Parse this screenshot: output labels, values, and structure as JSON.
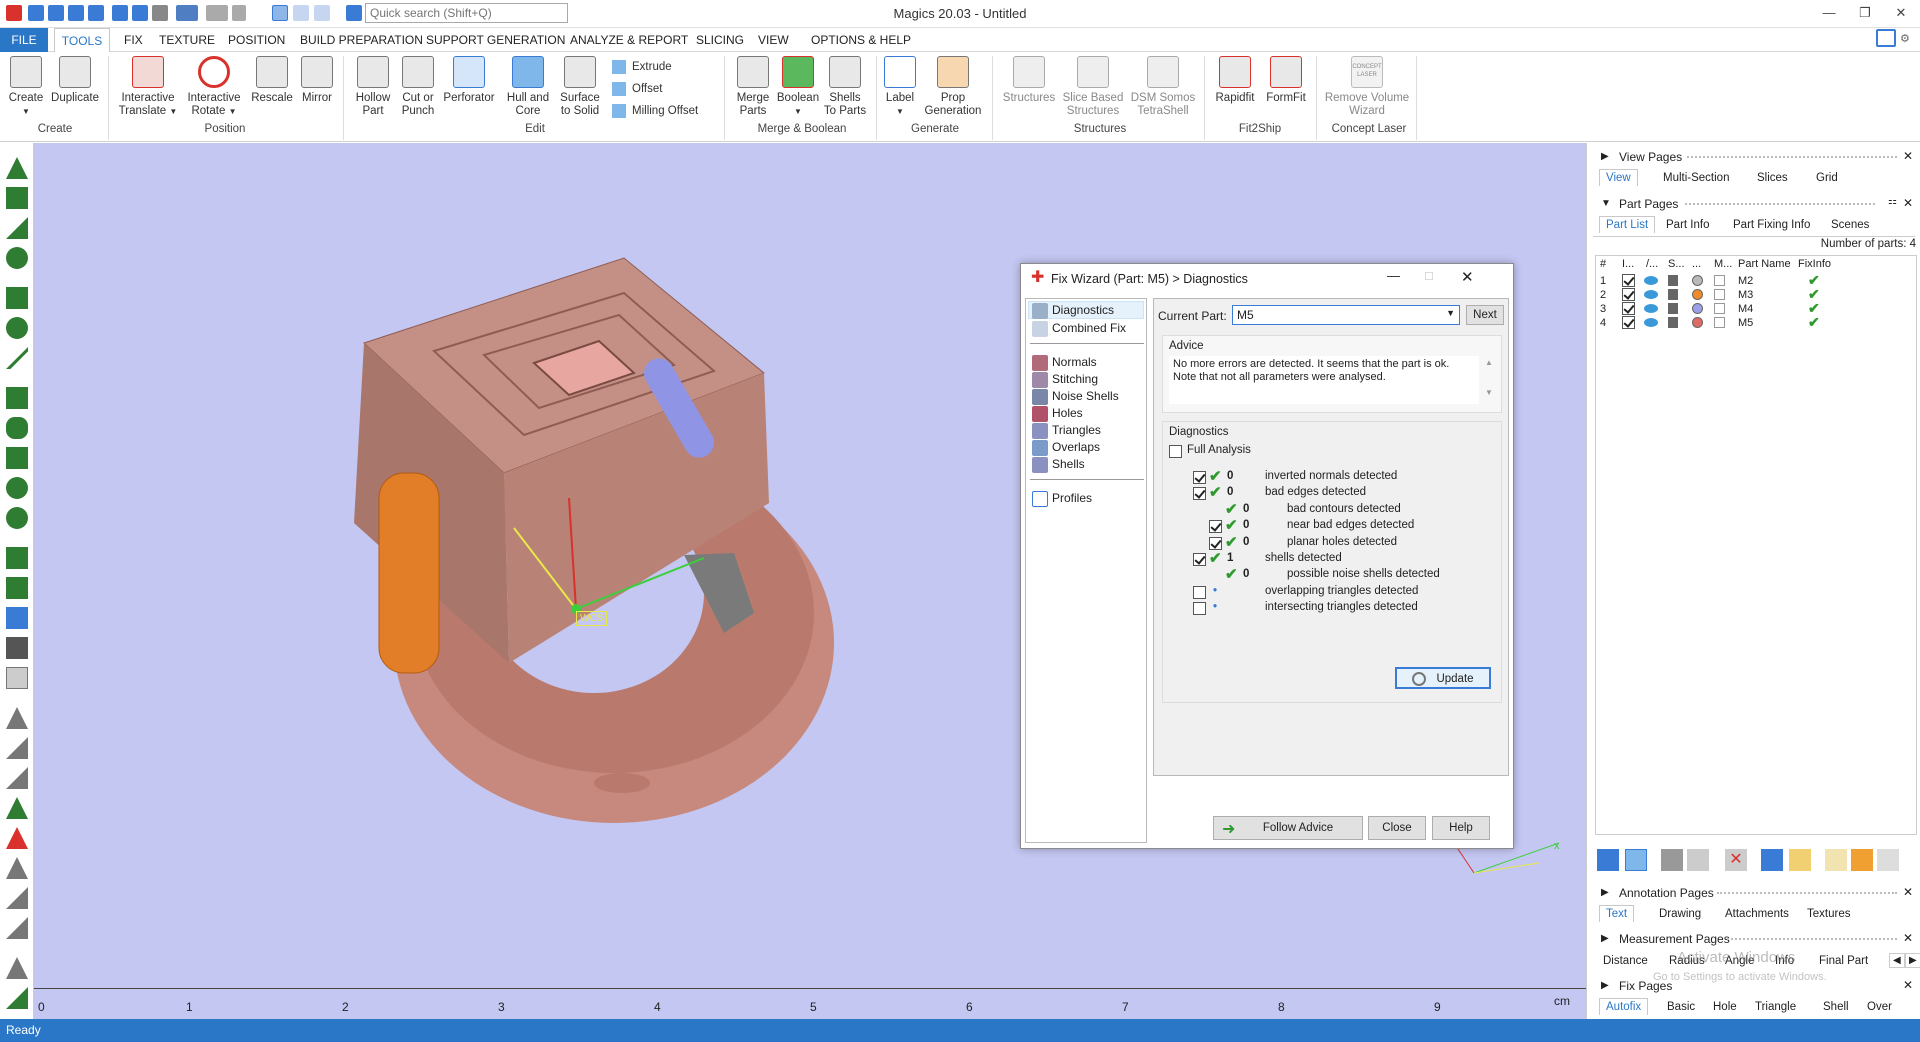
{
  "app": {
    "title": "Magics 20.03 - Untitled",
    "search_placeholder": "Quick search (Shift+Q)",
    "status": "Ready"
  },
  "menu": {
    "file": "FILE",
    "tabs": [
      "TOOLS",
      "FIX",
      "TEXTURE",
      "POSITION",
      "BUILD PREPARATION",
      "SUPPORT GENERATION",
      "ANALYZE & REPORT",
      "SLICING",
      "VIEW",
      "OPTIONS & HELP"
    ]
  },
  "ribbon": {
    "create": {
      "label": "Create",
      "btn_create": "Create",
      "btn_duplicate": "Duplicate"
    },
    "position": {
      "label": "Position",
      "interactive_translate_1": "Interactive",
      "interactive_translate_2": "Translate",
      "interactive_rotate_1": "Interactive",
      "interactive_rotate_2": "Rotate",
      "rescale": "Rescale",
      "mirror": "Mirror"
    },
    "edit": {
      "label": "Edit",
      "hollow_1": "Hollow",
      "hollow_2": "Part",
      "cut_1": "Cut or",
      "cut_2": "Punch",
      "perforator": "Perforator",
      "hull_1": "Hull and",
      "hull_2": "Core",
      "surface_1": "Surface",
      "surface_2": "to Solid",
      "extrude": "Extrude",
      "offset": "Offset",
      "milling": "Milling Offset"
    },
    "merge": {
      "label": "Merge & Boolean",
      "merge_1": "Merge",
      "merge_2": "Parts",
      "boolean": "Boolean",
      "shells_1": "Shells",
      "shells_2": "To Parts"
    },
    "generate": {
      "label": "Generate",
      "label_btn": "Label",
      "prop_1": "Prop",
      "prop_2": "Generation"
    },
    "structures": {
      "label": "Structures",
      "structures_btn": "Structures",
      "slice_1": "Slice Based",
      "slice_2": "Structures",
      "dsm_1": "DSM Somos",
      "dsm_2": "TetraShell"
    },
    "fit2ship": {
      "label": "Fit2Ship",
      "rapidfit": "Rapidfit",
      "formfit": "FormFit"
    },
    "concept": {
      "label": "Concept Laser",
      "remove_1": "Remove Volume",
      "remove_2": "Wizard",
      "logo_1": "CONCEPT",
      "logo_2": "LASER"
    }
  },
  "ruler": {
    "ticks": [
      "0",
      "1",
      "2",
      "3",
      "4",
      "5",
      "6",
      "7",
      "8",
      "9"
    ],
    "unit": "cm"
  },
  "viewport": {
    "wcs_label": "WCS"
  },
  "right_panel": {
    "view_pages": "View Pages",
    "view_tabs": [
      "View",
      "Multi-Section",
      "Slices",
      "Grid"
    ],
    "part_pages": "Part Pages",
    "part_tabs": [
      "Part List",
      "Part Info",
      "Part Fixing Info",
      "Scenes"
    ],
    "number_of_parts": "Number of parts: 4",
    "columns": [
      "#",
      "I...",
      "/...",
      "S...",
      "...",
      "M...",
      "Part Name",
      "FixInfo"
    ],
    "parts": [
      {
        "num": "1",
        "name": "M2",
        "color": "#b9b9b9"
      },
      {
        "num": "2",
        "name": "M3",
        "color": "#f08a2b"
      },
      {
        "num": "3",
        "name": "M4",
        "color": "#9aa0e8"
      },
      {
        "num": "4",
        "name": "M5",
        "color": "#e06a66"
      }
    ],
    "annotation_pages": "Annotation Pages",
    "annotation_tabs": [
      "Text",
      "Drawing",
      "Attachments",
      "Textures"
    ],
    "measurement_pages": "Measurement Pages",
    "measurement_tabs": [
      "Distance",
      "Radius",
      "Angle",
      "Info",
      "Final Part"
    ],
    "fix_pages": "Fix Pages",
    "fix_tabs": [
      "Autofix",
      "Basic",
      "Hole",
      "Triangle",
      "Shell",
      "Over"
    ],
    "watermark_1": "Activate Windows",
    "watermark_2": "Go to Settings to activate Windows."
  },
  "dialog": {
    "title": "Fix Wizard (Part: M5) > Diagnostics",
    "nav": [
      "Diagnostics",
      "Combined Fix",
      "Normals",
      "Stitching",
      "Noise Shells",
      "Holes",
      "Triangles",
      "Overlaps",
      "Shells",
      "Profiles"
    ],
    "current_part_label": "Current Part:",
    "current_part_value": "M5",
    "next": "Next",
    "advice_label": "Advice",
    "advice_line1": "No more errors are detected. It seems that the part is ok.",
    "advice_line2": "Note that not all parameters were analysed.",
    "diagnostics_label": "Diagnostics",
    "full_analysis": "Full Analysis",
    "rows": [
      {
        "count": "0",
        "text": "inverted normals detected"
      },
      {
        "count": "0",
        "text": "bad edges detected"
      },
      {
        "count": "0",
        "text": "bad contours detected"
      },
      {
        "count": "0",
        "text": "near bad edges detected"
      },
      {
        "count": "0",
        "text": "planar holes detected"
      },
      {
        "count": "1",
        "text": "shells detected"
      },
      {
        "count": "0",
        "text": "possible noise shells detected"
      },
      {
        "count": "•",
        "text": "overlapping triangles detected"
      },
      {
        "count": "•",
        "text": "intersecting triangles detected"
      }
    ],
    "update": "Update",
    "follow_advice": "Follow Advice",
    "close": "Close",
    "help": "Help"
  }
}
